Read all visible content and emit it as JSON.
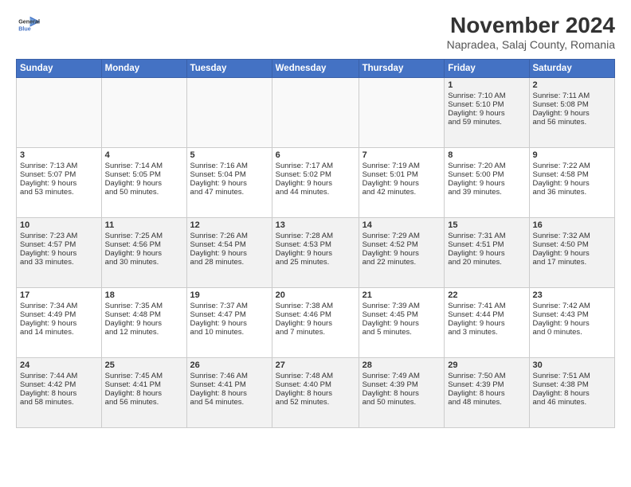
{
  "header": {
    "logo_line1": "General",
    "logo_line2": "Blue",
    "month": "November 2024",
    "location": "Napradea, Salaj County, Romania"
  },
  "days_of_week": [
    "Sunday",
    "Monday",
    "Tuesday",
    "Wednesday",
    "Thursday",
    "Friday",
    "Saturday"
  ],
  "weeks": [
    [
      {
        "day": "",
        "info": ""
      },
      {
        "day": "",
        "info": ""
      },
      {
        "day": "",
        "info": ""
      },
      {
        "day": "",
        "info": ""
      },
      {
        "day": "",
        "info": ""
      },
      {
        "day": "1",
        "info": "Sunrise: 7:10 AM\nSunset: 5:10 PM\nDaylight: 9 hours\nand 59 minutes."
      },
      {
        "day": "2",
        "info": "Sunrise: 7:11 AM\nSunset: 5:08 PM\nDaylight: 9 hours\nand 56 minutes."
      }
    ],
    [
      {
        "day": "3",
        "info": "Sunrise: 7:13 AM\nSunset: 5:07 PM\nDaylight: 9 hours\nand 53 minutes."
      },
      {
        "day": "4",
        "info": "Sunrise: 7:14 AM\nSunset: 5:05 PM\nDaylight: 9 hours\nand 50 minutes."
      },
      {
        "day": "5",
        "info": "Sunrise: 7:16 AM\nSunset: 5:04 PM\nDaylight: 9 hours\nand 47 minutes."
      },
      {
        "day": "6",
        "info": "Sunrise: 7:17 AM\nSunset: 5:02 PM\nDaylight: 9 hours\nand 44 minutes."
      },
      {
        "day": "7",
        "info": "Sunrise: 7:19 AM\nSunset: 5:01 PM\nDaylight: 9 hours\nand 42 minutes."
      },
      {
        "day": "8",
        "info": "Sunrise: 7:20 AM\nSunset: 5:00 PM\nDaylight: 9 hours\nand 39 minutes."
      },
      {
        "day": "9",
        "info": "Sunrise: 7:22 AM\nSunset: 4:58 PM\nDaylight: 9 hours\nand 36 minutes."
      }
    ],
    [
      {
        "day": "10",
        "info": "Sunrise: 7:23 AM\nSunset: 4:57 PM\nDaylight: 9 hours\nand 33 minutes."
      },
      {
        "day": "11",
        "info": "Sunrise: 7:25 AM\nSunset: 4:56 PM\nDaylight: 9 hours\nand 30 minutes."
      },
      {
        "day": "12",
        "info": "Sunrise: 7:26 AM\nSunset: 4:54 PM\nDaylight: 9 hours\nand 28 minutes."
      },
      {
        "day": "13",
        "info": "Sunrise: 7:28 AM\nSunset: 4:53 PM\nDaylight: 9 hours\nand 25 minutes."
      },
      {
        "day": "14",
        "info": "Sunrise: 7:29 AM\nSunset: 4:52 PM\nDaylight: 9 hours\nand 22 minutes."
      },
      {
        "day": "15",
        "info": "Sunrise: 7:31 AM\nSunset: 4:51 PM\nDaylight: 9 hours\nand 20 minutes."
      },
      {
        "day": "16",
        "info": "Sunrise: 7:32 AM\nSunset: 4:50 PM\nDaylight: 9 hours\nand 17 minutes."
      }
    ],
    [
      {
        "day": "17",
        "info": "Sunrise: 7:34 AM\nSunset: 4:49 PM\nDaylight: 9 hours\nand 14 minutes."
      },
      {
        "day": "18",
        "info": "Sunrise: 7:35 AM\nSunset: 4:48 PM\nDaylight: 9 hours\nand 12 minutes."
      },
      {
        "day": "19",
        "info": "Sunrise: 7:37 AM\nSunset: 4:47 PM\nDaylight: 9 hours\nand 10 minutes."
      },
      {
        "day": "20",
        "info": "Sunrise: 7:38 AM\nSunset: 4:46 PM\nDaylight: 9 hours\nand 7 minutes."
      },
      {
        "day": "21",
        "info": "Sunrise: 7:39 AM\nSunset: 4:45 PM\nDaylight: 9 hours\nand 5 minutes."
      },
      {
        "day": "22",
        "info": "Sunrise: 7:41 AM\nSunset: 4:44 PM\nDaylight: 9 hours\nand 3 minutes."
      },
      {
        "day": "23",
        "info": "Sunrise: 7:42 AM\nSunset: 4:43 PM\nDaylight: 9 hours\nand 0 minutes."
      }
    ],
    [
      {
        "day": "24",
        "info": "Sunrise: 7:44 AM\nSunset: 4:42 PM\nDaylight: 8 hours\nand 58 minutes."
      },
      {
        "day": "25",
        "info": "Sunrise: 7:45 AM\nSunset: 4:41 PM\nDaylight: 8 hours\nand 56 minutes."
      },
      {
        "day": "26",
        "info": "Sunrise: 7:46 AM\nSunset: 4:41 PM\nDaylight: 8 hours\nand 54 minutes."
      },
      {
        "day": "27",
        "info": "Sunrise: 7:48 AM\nSunset: 4:40 PM\nDaylight: 8 hours\nand 52 minutes."
      },
      {
        "day": "28",
        "info": "Sunrise: 7:49 AM\nSunset: 4:39 PM\nDaylight: 8 hours\nand 50 minutes."
      },
      {
        "day": "29",
        "info": "Sunrise: 7:50 AM\nSunset: 4:39 PM\nDaylight: 8 hours\nand 48 minutes."
      },
      {
        "day": "30",
        "info": "Sunrise: 7:51 AM\nSunset: 4:38 PM\nDaylight: 8 hours\nand 46 minutes."
      }
    ]
  ]
}
